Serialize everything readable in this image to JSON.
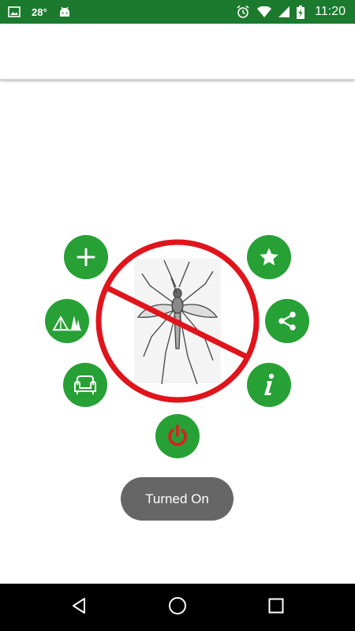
{
  "status_bar": {
    "temperature": "28°",
    "time": "11:20",
    "icons": [
      "image-icon",
      "android-icon",
      "alarm-icon",
      "wifi-icon",
      "signal-icon",
      "battery-charging-icon"
    ]
  },
  "colors": {
    "status_bar": "#1b7a2e",
    "button_green": "#27a035",
    "prohibition_red": "#e0141b",
    "power_red": "#e11a22",
    "toast_bg": "#666666",
    "nav_bar": "#000000"
  },
  "buttons": {
    "left": [
      "plus-icon",
      "camping-tent-icon",
      "armchair-icon"
    ],
    "right": [
      "star-icon",
      "share-icon",
      "info-icon"
    ],
    "center": "power-icon"
  },
  "toast": {
    "text": "Turned On"
  },
  "nav_bar": {
    "icons": [
      "back-icon",
      "home-icon",
      "recents-icon"
    ]
  }
}
